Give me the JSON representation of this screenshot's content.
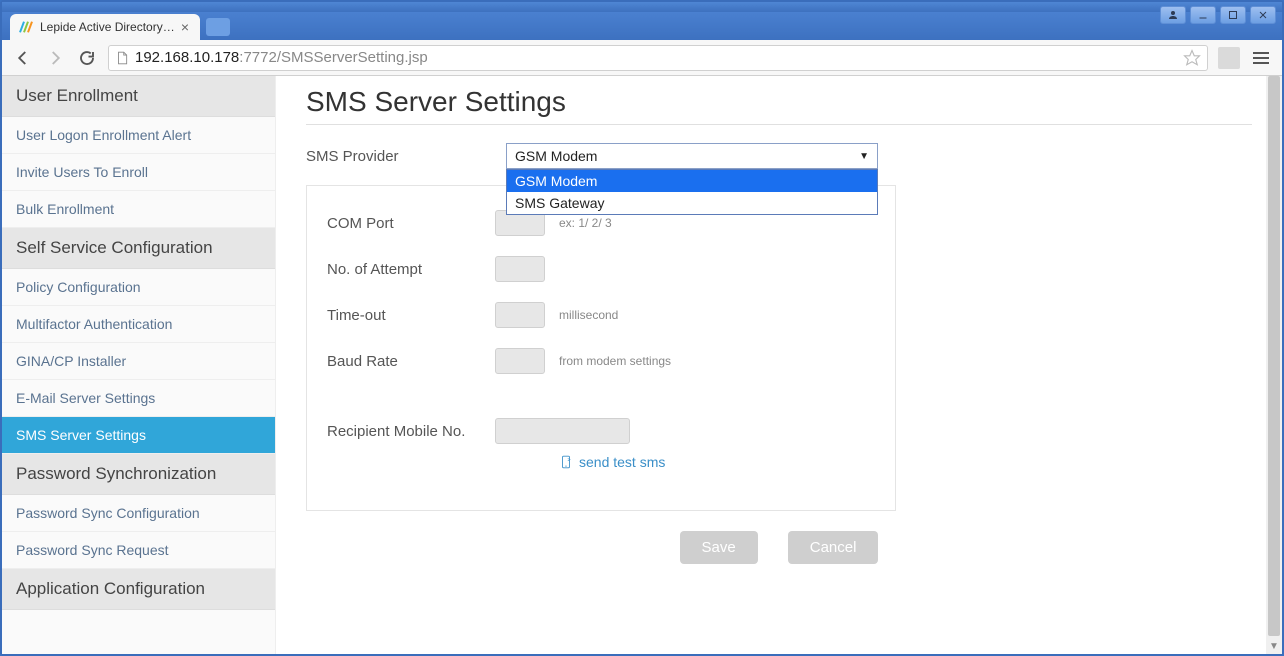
{
  "window": {
    "tab_title": "Lepide Active Directory Self"
  },
  "address": {
    "host": "192.168.10.178",
    "rest": ":7772/SMSServerSetting.jsp"
  },
  "sidebar": {
    "sections": [
      {
        "title": "User Enrollment",
        "items": [
          "User Logon Enrollment Alert",
          "Invite Users To Enroll",
          "Bulk Enrollment"
        ]
      },
      {
        "title": "Self Service Configuration",
        "items": [
          "Policy Configuration",
          "Multifactor Authentication",
          "GINA/CP Installer",
          "E-Mail Server Settings",
          "SMS Server Settings"
        ]
      },
      {
        "title": "Password Synchronization",
        "items": [
          "Password Sync Configuration",
          "Password Sync Request"
        ]
      },
      {
        "title": "Application Configuration",
        "items": []
      }
    ],
    "active": "SMS Server Settings"
  },
  "page": {
    "title": "SMS Server Settings",
    "sms_provider_label": "SMS Provider",
    "sms_provider_value": "GSM Modem",
    "sms_provider_options": [
      "GSM Modem",
      "SMS Gateway"
    ],
    "fields": {
      "com_port": {
        "label": "COM Port",
        "hint": "ex: 1/ 2/ 3"
      },
      "no_of_attempt": {
        "label": "No. of Attempt",
        "hint": ""
      },
      "time_out": {
        "label": "Time-out",
        "hint": "millisecond"
      },
      "baud_rate": {
        "label": "Baud Rate",
        "hint": "from modem settings"
      },
      "recipient": {
        "label": "Recipient Mobile No."
      }
    },
    "send_test_label": "send test sms",
    "save_label": "Save",
    "cancel_label": "Cancel"
  }
}
